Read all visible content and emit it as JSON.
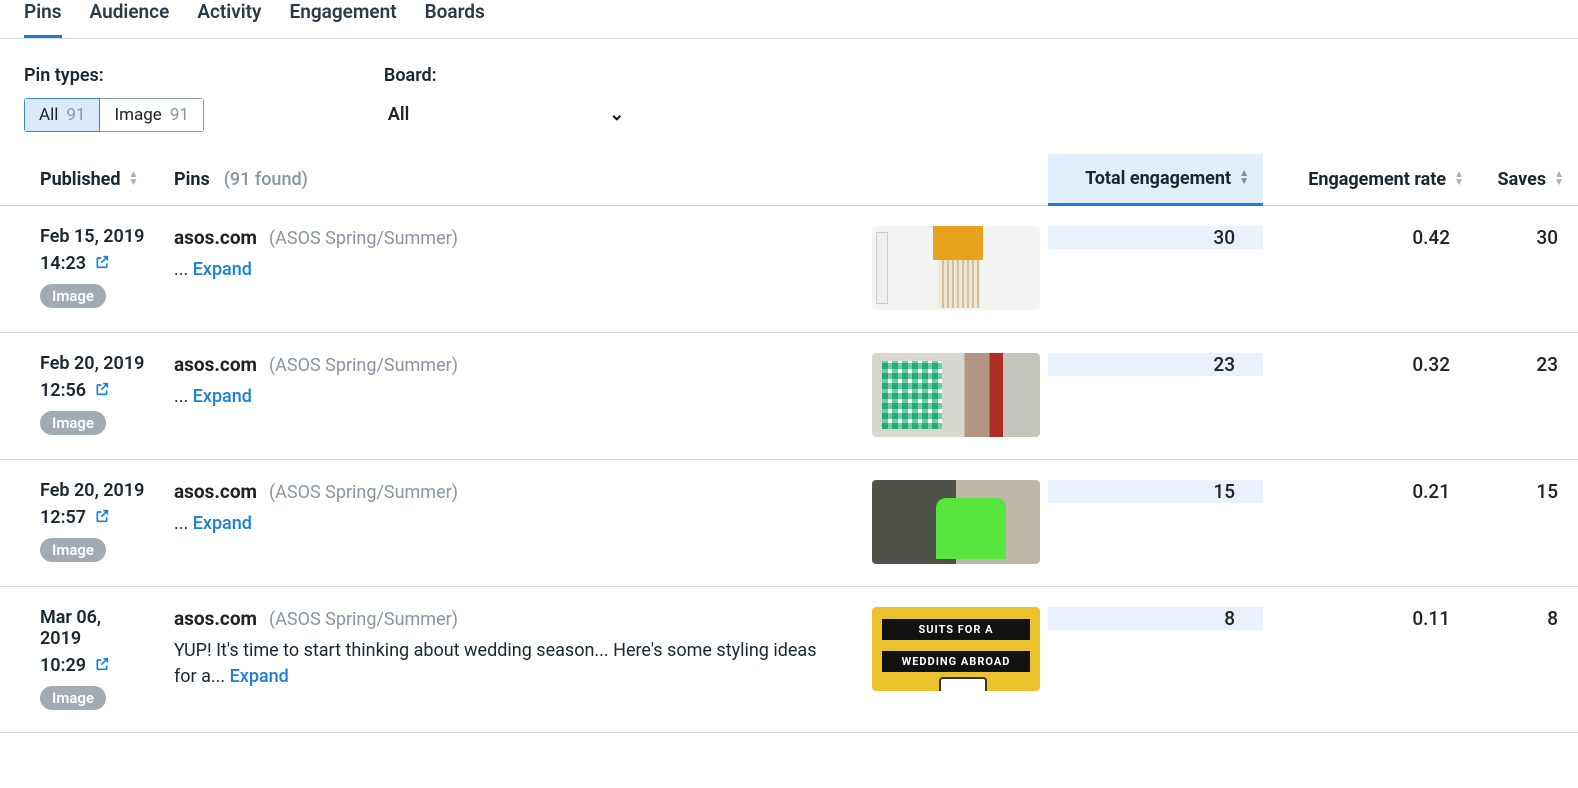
{
  "tabs": {
    "pins": "Pins",
    "audience": "Audience",
    "activity": "Activity",
    "engagement": "Engagement",
    "boards": "Boards"
  },
  "filters": {
    "pin_types_label": "Pin types:",
    "board_label": "Board:",
    "segment_all_label": "All",
    "segment_all_count": "91",
    "segment_image_label": "Image",
    "segment_image_count": "91",
    "board_selected": "All"
  },
  "columns": {
    "published": "Published",
    "pins": "Pins",
    "pins_count": "(91 found)",
    "total_engagement": "Total engagement",
    "engagement_rate": "Engagement rate",
    "saves": "Saves"
  },
  "common": {
    "expand": "Expand",
    "ellipsis": "...",
    "type_image": "Image"
  },
  "rows": [
    {
      "date": "Feb 15, 2019",
      "time": "14:23",
      "source": "asos.com",
      "board": "(ASOS Spring/Summer)",
      "desc": "",
      "total_engagement": "30",
      "engagement_rate": "0.42",
      "saves": "30"
    },
    {
      "date": "Feb 20, 2019",
      "time": "12:56",
      "source": "asos.com",
      "board": "(ASOS Spring/Summer)",
      "desc": "",
      "total_engagement": "23",
      "engagement_rate": "0.32",
      "saves": "23"
    },
    {
      "date": "Feb 20, 2019",
      "time": "12:57",
      "source": "asos.com",
      "board": "(ASOS Spring/Summer)",
      "desc": "",
      "total_engagement": "15",
      "engagement_rate": "0.21",
      "saves": "15"
    },
    {
      "date": "Mar 06, 2019",
      "time": "10:29",
      "source": "asos.com",
      "board": "(ASOS Spring/Summer)",
      "desc": "YUP! It's time to start thinking about wedding season... Here's some styling ideas for a...",
      "total_engagement": "8",
      "engagement_rate": "0.11",
      "saves": "8"
    }
  ],
  "thumb4": {
    "line1": "SUITS FOR A",
    "line2": "WEDDING ABROAD"
  }
}
